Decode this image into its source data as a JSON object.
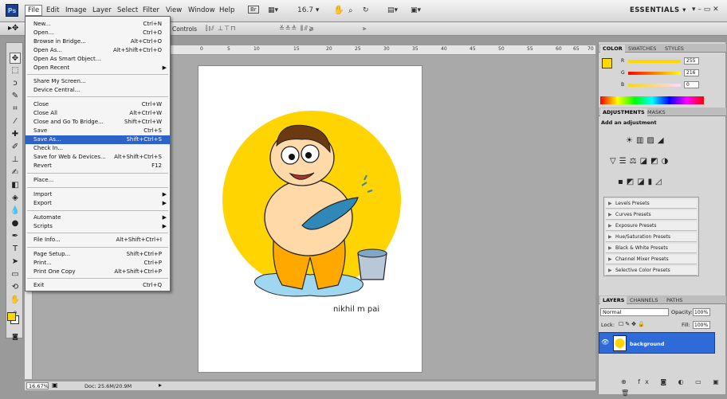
{
  "app": {
    "logo": "Ps",
    "workspace": "ESSENTIALS",
    "window_controls": "▾ – ▭ ✕",
    "zoom_menu": "16.7"
  },
  "menubar": [
    "File",
    "Edit",
    "Image",
    "Layer",
    "Select",
    "Filter",
    "View",
    "Window",
    "Help"
  ],
  "options_bar": {
    "controls_label": "Controls"
  },
  "file_menu": {
    "items": [
      {
        "label": "New...",
        "shortcut": "Ctrl+N"
      },
      {
        "label": "Open...",
        "shortcut": "Ctrl+O"
      },
      {
        "label": "Browse in Bridge...",
        "shortcut": "Alt+Ctrl+O"
      },
      {
        "label": "Open As...",
        "shortcut": "Alt+Shift+Ctrl+O"
      },
      {
        "label": "Open As Smart Object...",
        "shortcut": ""
      },
      {
        "label": "Open Recent",
        "shortcut": ""
      },
      {
        "label": "Share My Screen...",
        "shortcut": ""
      },
      {
        "label": "Device Central...",
        "shortcut": ""
      },
      {
        "label": "Close",
        "shortcut": "Ctrl+W"
      },
      {
        "label": "Close All",
        "shortcut": "Alt+Ctrl+W"
      },
      {
        "label": "Close and Go To Bridge...",
        "shortcut": "Shift+Ctrl+W"
      },
      {
        "label": "Save",
        "shortcut": "Ctrl+S"
      },
      {
        "label": "Save As...",
        "shortcut": "Shift+Ctrl+S"
      },
      {
        "label": "Check In...",
        "shortcut": ""
      },
      {
        "label": "Save for Web & Devices...",
        "shortcut": "Alt+Shift+Ctrl+S"
      },
      {
        "label": "Revert",
        "shortcut": "F12"
      },
      {
        "label": "Place...",
        "shortcut": ""
      },
      {
        "label": "Import",
        "shortcut": ""
      },
      {
        "label": "Export",
        "shortcut": ""
      },
      {
        "label": "Automate",
        "shortcut": ""
      },
      {
        "label": "Scripts",
        "shortcut": ""
      },
      {
        "label": "File Info...",
        "shortcut": "Alt+Shift+Ctrl+I"
      },
      {
        "label": "Page Setup...",
        "shortcut": "Shift+Ctrl+P"
      },
      {
        "label": "Print...",
        "shortcut": "Ctrl+P"
      },
      {
        "label": "Print One Copy",
        "shortcut": "Alt+Shift+Ctrl+P"
      },
      {
        "label": "Exit",
        "shortcut": "Ctrl+Q"
      }
    ],
    "highlighted": "Save As..."
  },
  "ruler": {
    "top_labels": [
      "0",
      "5",
      "10",
      "15",
      "20",
      "25",
      "30",
      "35",
      "40",
      "45",
      "50",
      "55",
      "60",
      "65",
      "70"
    ]
  },
  "document": {
    "signature": "nikhil m pai"
  },
  "status": {
    "zoom": "16.67%",
    "doc": "Doc: 25.6M/20.9M"
  },
  "color_panel": {
    "tabs": [
      "COLOR",
      "SWATCHES",
      "STYLES"
    ],
    "channels": [
      {
        "label": "R",
        "value": "255"
      },
      {
        "label": "G",
        "value": "216"
      },
      {
        "label": "B",
        "value": "0"
      }
    ],
    "foreground": "#ffd800"
  },
  "adjustments_panel": {
    "tabs": [
      "ADJUSTMENTS",
      "MASKS"
    ],
    "heading": "Add an adjustment",
    "presets": [
      "Levels Presets",
      "Curves Presets",
      "Exposure Presets",
      "Hue/Saturation Presets",
      "Black & White Presets",
      "Channel Mixer Presets",
      "Selective Color Presets"
    ]
  },
  "layers_panel": {
    "tabs": [
      "LAYERS",
      "CHANNELS",
      "PATHS"
    ],
    "blend_mode": "Normal",
    "opacity_label": "Opacity:",
    "opacity": "100%",
    "lock_label": "Lock:",
    "fill_label": "Fill:",
    "fill": "100%",
    "layer_name": "background"
  }
}
